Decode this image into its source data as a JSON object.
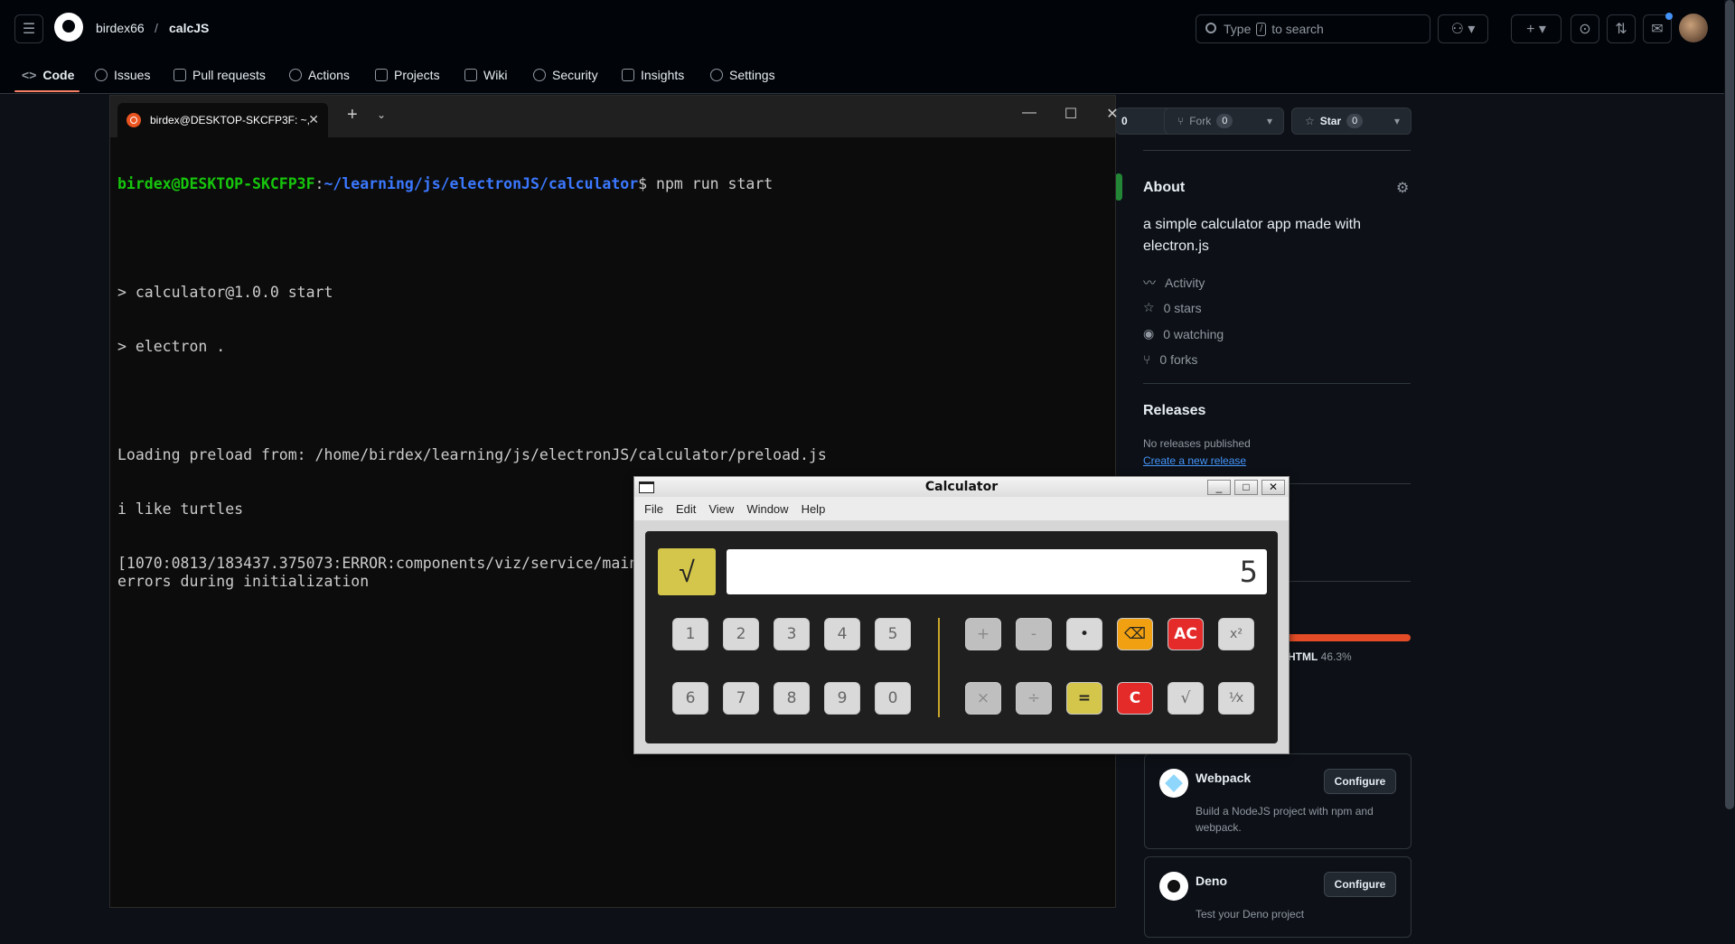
{
  "github": {
    "owner": "birdex66",
    "separator": "/",
    "repo": "calcJS",
    "search_placeholder_pre": "Type",
    "search_key": "/",
    "search_placeholder_post": "to search",
    "tabs": [
      {
        "label": "Code"
      },
      {
        "label": "Issues"
      },
      {
        "label": "Pull requests"
      },
      {
        "label": "Actions"
      },
      {
        "label": "Projects"
      },
      {
        "label": "Wiki"
      },
      {
        "label": "Security"
      },
      {
        "label": "Insights"
      },
      {
        "label": "Settings"
      }
    ],
    "watch_count": "0",
    "fork_label": "Fork",
    "fork_count": "0",
    "star_label": "Star",
    "star_count": "0",
    "about_title": "About",
    "about_desc": "a simple calculator app made with electron.js",
    "stats": [
      {
        "label": "Activity"
      },
      {
        "label": "0 stars"
      },
      {
        "label": "0 watching"
      },
      {
        "label": "0 forks"
      }
    ],
    "releases_title": "Releases",
    "releases_none": "No releases published",
    "releases_link": "Create a new release",
    "language_name": "HTML",
    "language_pct": "46.3%",
    "workflows": [
      {
        "name": "Webpack",
        "desc": "Build a NodeJS project with npm and webpack.",
        "button": "Configure"
      },
      {
        "name": "Deno",
        "desc": "Test your Deno project",
        "button": "Configure"
      }
    ],
    "colors": {
      "accent": "#f78166",
      "link": "#4493f8",
      "lang_html": "#e34c26"
    }
  },
  "terminal": {
    "tab_title": "birdex@DESKTOP-SKCFP3F: ~,",
    "prompt_user": "birdex@DESKTOP-SKCFP3F",
    "prompt_colon": ":",
    "prompt_path": "~/learning/js/electronJS/calculator",
    "prompt_dollar": "$ ",
    "command": "npm run start",
    "lines": [
      "",
      "> calculator@1.0.0 start",
      "> electron .",
      "",
      "Loading preload from: /home/birdex/learning/js/electronJS/calculator/preload.js",
      "i like turtles",
      "[1070:0813/183437.375073:ERROR:components/viz/service/main/viz_main_impl.cc:183] Exiting GPU process due to errors during initialization"
    ]
  },
  "calculator": {
    "title": "Calculator",
    "menu": [
      "File",
      "Edit",
      "View",
      "Window",
      "Help"
    ],
    "sqrt_label": "√",
    "display_value": "5",
    "digits_row1": [
      "1",
      "2",
      "3",
      "4",
      "5"
    ],
    "digits_row2": [
      "6",
      "7",
      "8",
      "9",
      "0"
    ],
    "ops_row1": [
      "+",
      "-",
      "•",
      "⌫",
      "AC",
      "x²"
    ],
    "ops_row2": [
      "×",
      "÷",
      "=",
      "C",
      "√",
      "¹⁄x"
    ],
    "colors": {
      "yellow": "#d4c64a",
      "orange": "#f0a011",
      "red": "#e52a2a"
    }
  }
}
